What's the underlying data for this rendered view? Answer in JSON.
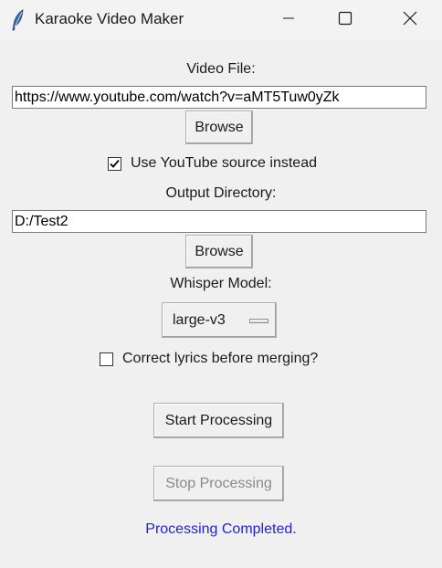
{
  "window": {
    "title": "Karaoke Video Maker"
  },
  "video": {
    "label": "Video File:",
    "value": "https://www.youtube.com/watch?v=aMT5Tuw0yZk",
    "browse_label": "Browse"
  },
  "youtube": {
    "label": "Use YouTube source instead",
    "checked": true
  },
  "output": {
    "label": "Output Directory:",
    "value": "D:/Test2",
    "browse_label": "Browse"
  },
  "whisper": {
    "label": "Whisper Model:",
    "selected": "large-v3"
  },
  "correct": {
    "label": "Correct lyrics before merging?",
    "checked": false
  },
  "actions": {
    "start_label": "Start Processing",
    "stop_label": "Stop Processing",
    "stop_enabled": false
  },
  "status": {
    "text": "Processing Completed.",
    "color": "#1f1fe0"
  },
  "icons": {
    "app": "feather-icon",
    "minimize": "minimize-icon",
    "maximize": "maximize-icon",
    "close": "close-icon",
    "check": "checkmark-icon"
  }
}
